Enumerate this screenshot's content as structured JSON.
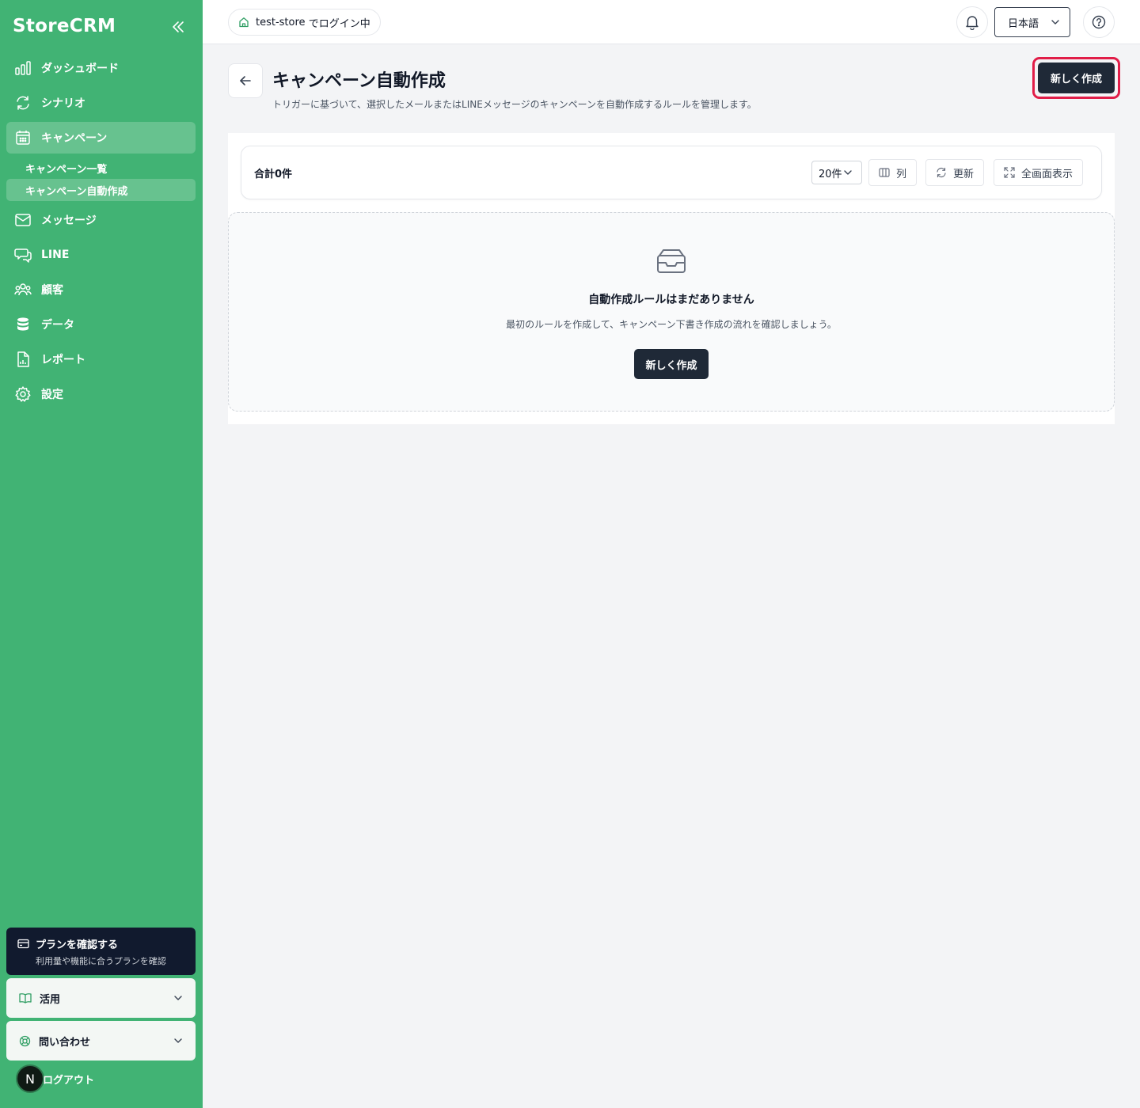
{
  "app": {
    "brand": "StoreCRM"
  },
  "sidebar": {
    "items": [
      {
        "label": "ダッシュボード",
        "icon": "bar-chart-icon"
      },
      {
        "label": "シナリオ",
        "icon": "refresh-cycle-icon"
      },
      {
        "label": "キャンペーン",
        "icon": "calendar-icon",
        "active": true
      },
      {
        "label": "メッセージ",
        "icon": "mail-icon"
      },
      {
        "label": "LINE",
        "icon": "chat-bubbles-icon"
      },
      {
        "label": "顧客",
        "icon": "users-icon"
      },
      {
        "label": "データ",
        "icon": "database-icon"
      },
      {
        "label": "レポート",
        "icon": "report-file-icon"
      },
      {
        "label": "設定",
        "icon": "gear-icon"
      }
    ],
    "sub_items": [
      {
        "label": "キャンペーン一覧"
      },
      {
        "label": "キャンペーン自動作成",
        "active": true
      }
    ],
    "plan": {
      "title": "プランを確認する",
      "subtitle": "利用量や機能に合うプランを確認"
    },
    "usage": {
      "label": "活用"
    },
    "contact": {
      "label": "問い合わせ"
    },
    "user": {
      "avatar_initial": "N",
      "logout_label": "ログアウト"
    }
  },
  "topbar": {
    "store_label": "test-store",
    "login_suffix": "でログイン中",
    "language": "日本語"
  },
  "page": {
    "title": "キャンペーン自動作成",
    "description": "トリガーに基づいて、選択したメールまたはLINEメッセージのキャンペーンを自動作成するルールを管理します。",
    "create_button": "新しく作成"
  },
  "toolbar": {
    "total": "合計0件",
    "page_size": "20件",
    "columns": "列",
    "refresh": "更新",
    "fullscreen": "全画面表示"
  },
  "empty_state": {
    "title": "自動作成ルールはまだありません",
    "description": "最初のルールを作成して、キャンペーン下書き作成の流れを確認しましょう。",
    "button": "新しく作成"
  },
  "colors": {
    "sidebar_bg": "#41b374",
    "primary": "#1f2937",
    "highlight_border": "#e11d48"
  }
}
